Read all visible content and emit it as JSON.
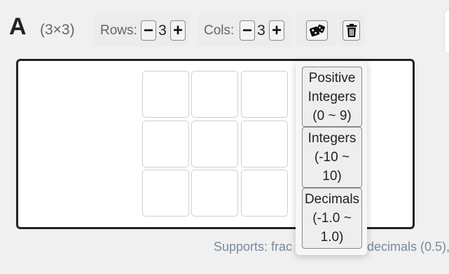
{
  "header": {
    "matrix_name": "A",
    "dimensions": "(3×3)",
    "rows_label": "Rows:",
    "rows_minus": "−",
    "rows_value": "3",
    "rows_plus": "+",
    "cols_label": "Cols:",
    "cols_minus": "−",
    "cols_value": "3",
    "cols_plus": "+",
    "random_icon": "dice-icon",
    "clear_icon": "trash-icon"
  },
  "matrix": {
    "rows": 3,
    "cols": 3,
    "cells": [
      [
        "",
        "",
        ""
      ],
      [
        "",
        "",
        ""
      ],
      [
        "",
        "",
        ""
      ]
    ]
  },
  "random_menu": {
    "options": [
      "Positive\nIntegers\n(0 ~ 9)",
      "Integers\n(-10 ~\n10)",
      "Decimals\n(-1.0 ~\n1.0)"
    ]
  },
  "footer": {
    "note_start": "Supports: frac",
    "note_end": "decimals (0.5),"
  },
  "colors": {
    "page_background": "#f0f0f0",
    "board_border": "#222222",
    "note_text": "#7a8a9a"
  }
}
